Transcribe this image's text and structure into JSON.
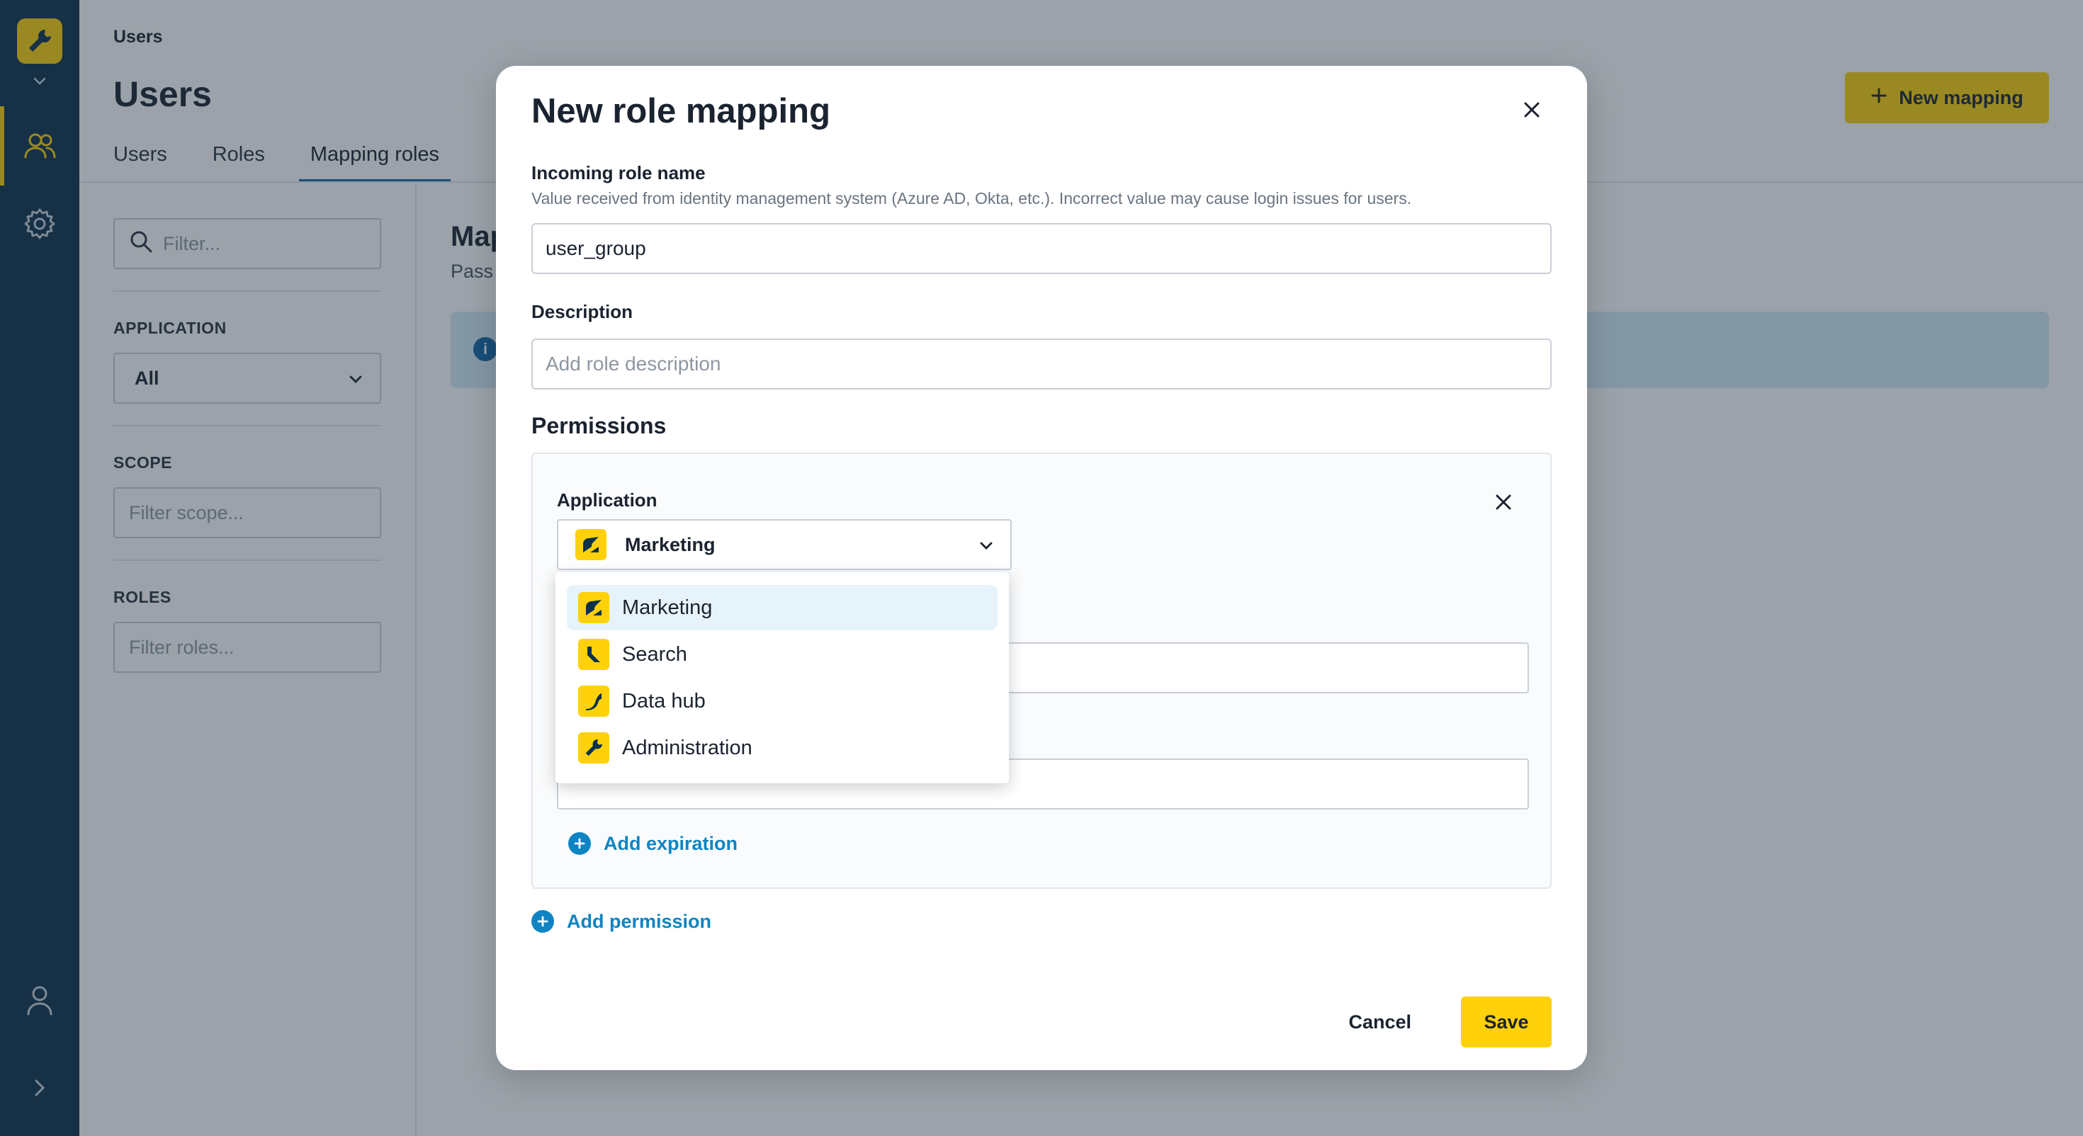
{
  "colors": {
    "rail": "#0d3149",
    "brand_yellow": "#fed10a",
    "link_blue": "#0f84c2",
    "tab_underline": "#1266a8"
  },
  "rail": {
    "logo_icon": "wrench-icon",
    "icons": [
      "chevron-down-icon",
      "users-icon",
      "gear-icon",
      "user-icon",
      "chevron-right-icon"
    ]
  },
  "page": {
    "breadcrumb": "Users",
    "title": "Users",
    "new_mapping_label": "New mapping",
    "tabs": [
      {
        "label": "Users"
      },
      {
        "label": "Roles"
      },
      {
        "label": "Mapping roles",
        "active": true
      }
    ],
    "sidebar": {
      "filter_placeholder": "Filter...",
      "application_label": "APPLICATION",
      "application_value": "All",
      "scope_label": "SCOPE",
      "scope_placeholder": "Filter scope...",
      "roles_label": "ROLES",
      "roles_placeholder": "Filter roles..."
    },
    "main_title_visible": "Map",
    "main_sub_visible": "Pass"
  },
  "modal": {
    "title": "New role mapping",
    "incoming_label": "Incoming role name",
    "incoming_help": "Value received from identity management system (Azure AD, Okta, etc.). Incorrect value may cause login issues for users.",
    "incoming_value": "user_group",
    "description_label": "Description",
    "description_placeholder": "Add role description",
    "permissions_title": "Permissions",
    "permission": {
      "application_label": "Application",
      "application_selected": "Marketing",
      "add_expiration_label": "Add expiration"
    },
    "dropdown_options": [
      {
        "label": "Marketing",
        "icon": "marketing-app-icon",
        "selected": true
      },
      {
        "label": "Search",
        "icon": "search-app-icon"
      },
      {
        "label": "Data hub",
        "icon": "data-hub-app-icon"
      },
      {
        "label": "Administration",
        "icon": "wrench-icon"
      }
    ],
    "add_permission_label": "Add permission",
    "cancel_label": "Cancel",
    "save_label": "Save"
  }
}
